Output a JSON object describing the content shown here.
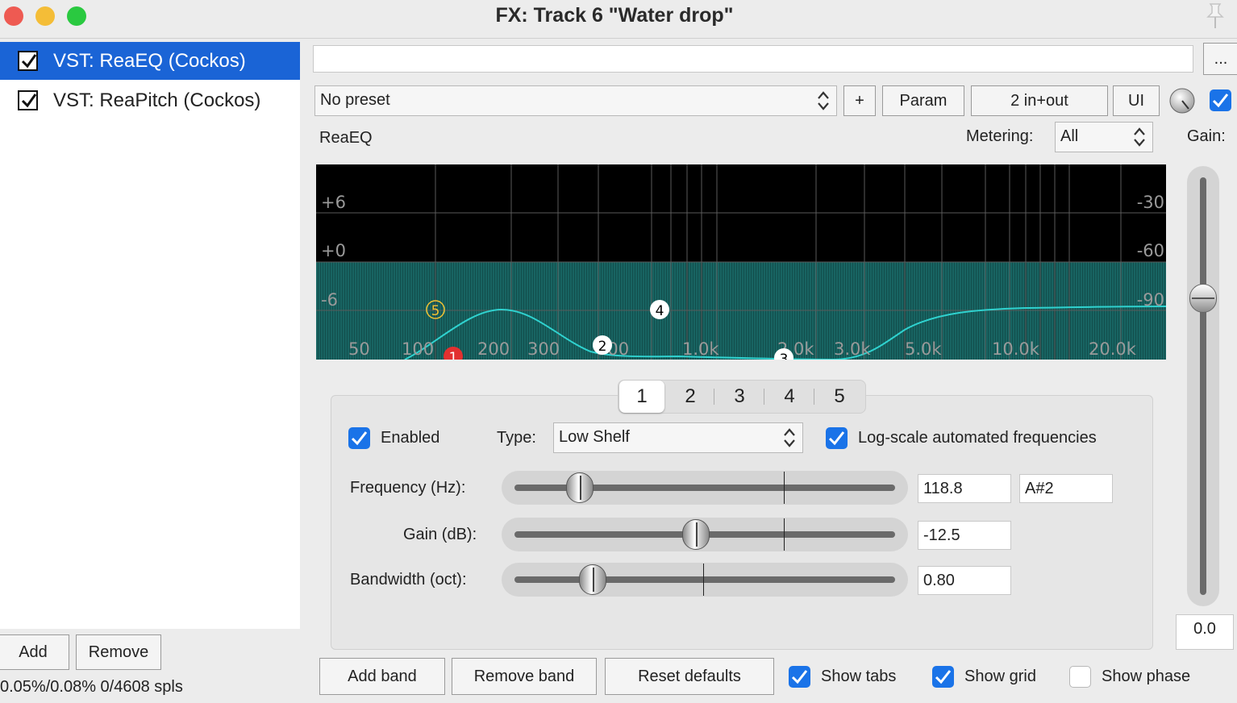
{
  "window": {
    "title": "FX: Track 6 \"Water drop\"",
    "traffic_lights": {
      "close": "#ee5a52",
      "minimize": "#f4bd37",
      "zoom": "#2ac940"
    }
  },
  "fx_chain": {
    "items": [
      {
        "label": "VST: ReaEQ (Cockos)",
        "enabled": true,
        "selected": true
      },
      {
        "label": "VST: ReaPitch (Cockos)",
        "enabled": true,
        "selected": false
      }
    ],
    "add_label": "Add",
    "remove_label": "Remove",
    "status": "0.05%/0.08% 0/4608 spls"
  },
  "toolbar": {
    "more_label": "...",
    "preset": "No preset",
    "plus_label": "+",
    "param_label": "Param",
    "io_label": "2 in+out",
    "ui_label": "UI",
    "bypass_checked": true
  },
  "plugin": {
    "name": "ReaEQ",
    "metering_label": "Metering:",
    "metering_value": "All",
    "gain_label": "Gain:",
    "gain_value": "0.0"
  },
  "eq_graph": {
    "db_labels_left": [
      "+6",
      "+0",
      "-6"
    ],
    "db_labels_right": [
      "-30",
      "-60",
      "-90"
    ],
    "freq_labels": [
      "50",
      "100",
      "200",
      "300",
      "500",
      "1.0k",
      "2.0k",
      "3.0k",
      "5.0k",
      "10.0k",
      "20.0k"
    ],
    "band_markers": [
      {
        "label": "1",
        "color": "#e23030"
      },
      {
        "label": "2",
        "color": "#ffffff"
      },
      {
        "label": "3",
        "color": "#ffffff"
      },
      {
        "label": "4",
        "color": "#ffffff"
      },
      {
        "label": "5",
        "color": "#f2c233"
      }
    ],
    "curve_color": "#2fd2cf",
    "fill_color": "#146e6c"
  },
  "band_tabs": {
    "labels": [
      "1",
      "2",
      "3",
      "4",
      "5"
    ],
    "active": "1"
  },
  "band": {
    "enabled_label": "Enabled",
    "enabled": true,
    "type_label": "Type:",
    "type_value": "Low Shelf",
    "log_scale_label": "Log-scale automated frequencies",
    "log_scale": true,
    "frequency_label": "Frequency (Hz):",
    "frequency_value": "118.8",
    "frequency_note": "A#2",
    "gain_label": "Gain (dB):",
    "gain_value": "-12.5",
    "bandwidth_label": "Bandwidth (oct):",
    "bandwidth_value": "0.80"
  },
  "bottom": {
    "add_band_label": "Add band",
    "remove_band_label": "Remove band",
    "reset_label": "Reset defaults",
    "show_tabs_label": "Show tabs",
    "show_tabs": true,
    "show_grid_label": "Show grid",
    "show_grid": true,
    "show_phase_label": "Show phase",
    "show_phase": false
  },
  "accent_color": "#1a73e8",
  "selection_color": "#1a64d6"
}
